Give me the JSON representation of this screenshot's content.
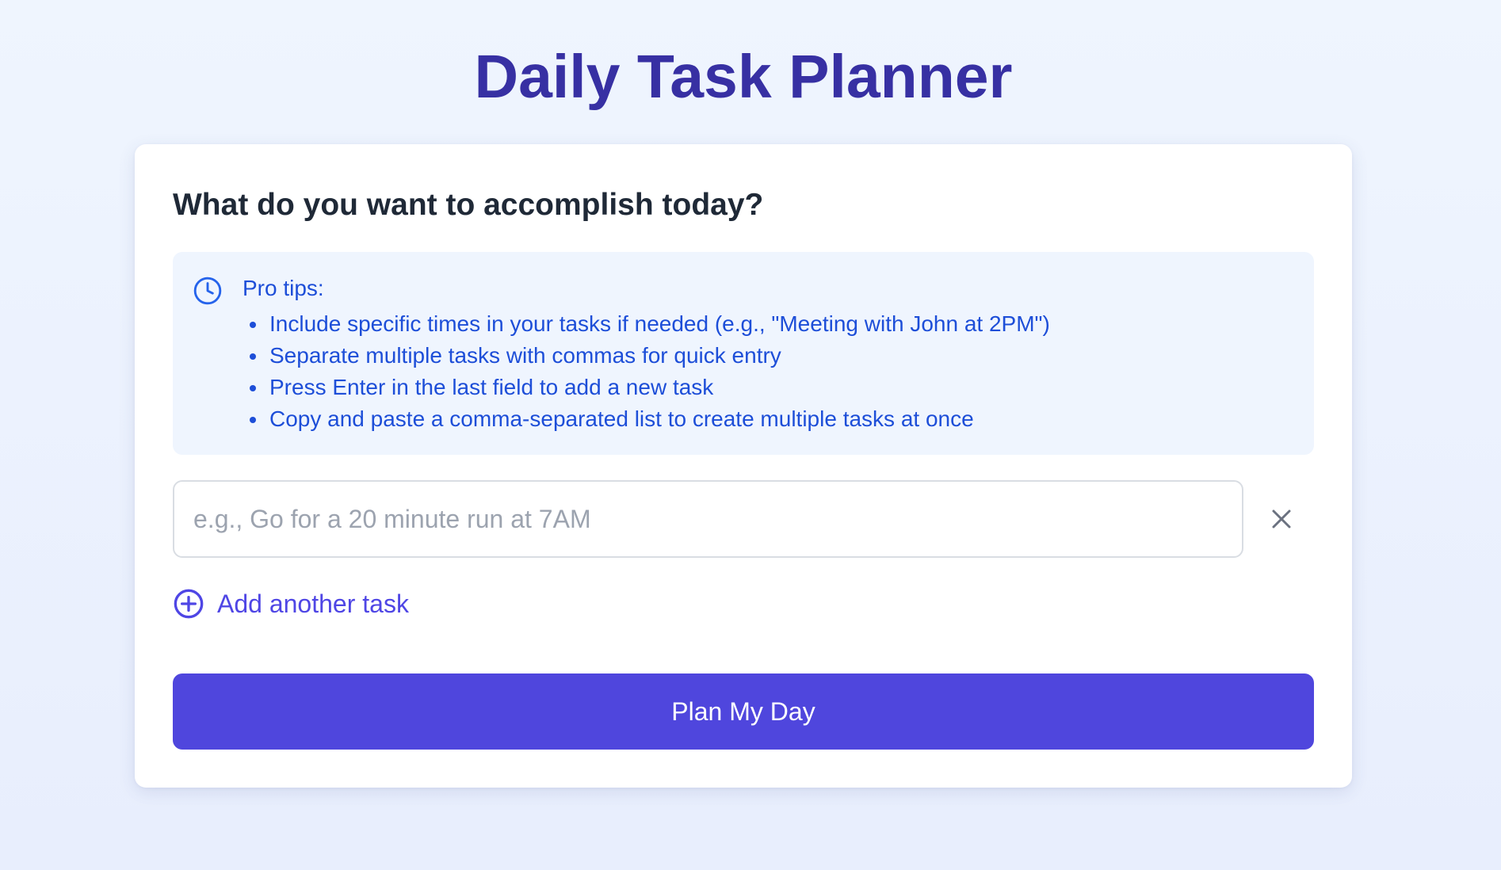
{
  "page": {
    "title": "Daily Task Planner"
  },
  "card": {
    "heading": "What do you want to accomplish today?"
  },
  "tips": {
    "icon": "clock-icon",
    "title": "Pro tips:",
    "items": [
      "Include specific times in your tasks if needed (e.g., \"Meeting with John at 2PM\")",
      "Separate multiple tasks with commas for quick entry",
      "Press Enter in the last field to add a new task",
      "Copy and paste a comma-separated list to create multiple tasks at once"
    ]
  },
  "task_input": {
    "value": "",
    "placeholder": "e.g., Go for a 20 minute run at 7AM",
    "remove_icon": "close-icon"
  },
  "add_task": {
    "icon": "plus-circle-icon",
    "label": "Add another task"
  },
  "plan_button": {
    "label": "Plan My Day"
  },
  "colors": {
    "title": "#3730a3",
    "accent": "#4f46e5",
    "button": "#4f46dd",
    "tips_text": "#1d4ed8",
    "tips_bg": "#eff5fe",
    "heading": "#1f2937",
    "placeholder": "#9ca3af"
  }
}
